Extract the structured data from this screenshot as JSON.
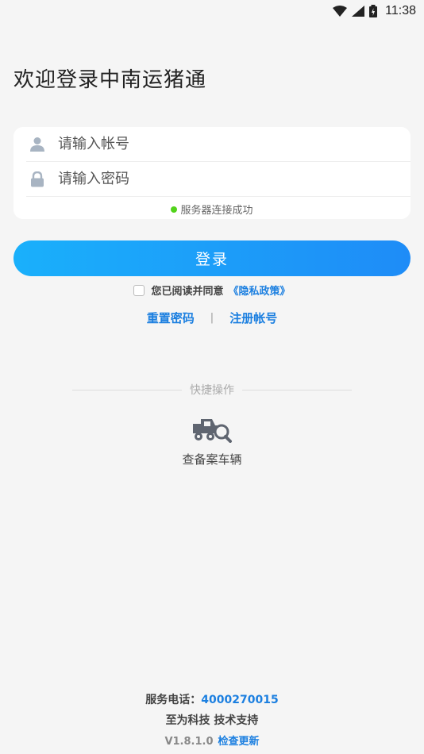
{
  "status_bar": {
    "time": "11:38",
    "icons": [
      "wifi-icon",
      "signal-icon",
      "battery-icon"
    ]
  },
  "welcome_title": "欢迎登录中南运猪通",
  "login_form": {
    "account_placeholder": "请输入帐号",
    "account_value": "",
    "password_placeholder": "请输入密码",
    "password_value": "",
    "account_icon": "user-icon",
    "password_icon": "lock-icon",
    "server_status": "服务器连接成功",
    "server_status_color": "#52d31b"
  },
  "login_button_label": "登录",
  "agreement": {
    "checked": false,
    "text": "您已阅读并同意",
    "policy_link": "《隐私政策》"
  },
  "account_links": {
    "reset_password": "重置密码",
    "separator": "|",
    "register": "注册帐号"
  },
  "quick_actions": {
    "title": "快捷操作",
    "items": [
      {
        "label": "查备案车辆",
        "icon": "truck-search-icon"
      }
    ]
  },
  "footer": {
    "service_phone_label": "服务电话：",
    "service_phone": "4000270015",
    "support": "至为科技 技术支持",
    "version": "V1.8.1.0",
    "check_update": "检查更新"
  },
  "colors": {
    "accent": "#1b7fe0",
    "button_gradient_start": "#1ab0fb",
    "button_gradient_end": "#1e8cf7",
    "background": "#f5f5f5"
  }
}
